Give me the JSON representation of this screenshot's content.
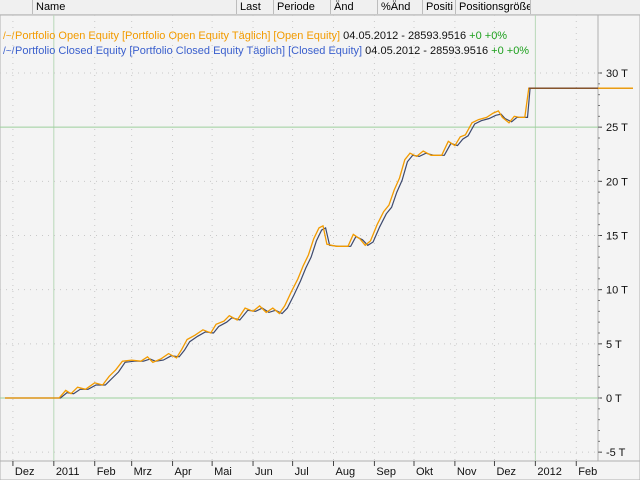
{
  "header": {
    "columns": [
      {
        "label": ""
      },
      {
        "label": "Name"
      },
      {
        "label": "Last"
      },
      {
        "label": "Periode"
      },
      {
        "label": "Änd"
      },
      {
        "label": "%Änd"
      },
      {
        "label": "Positi"
      },
      {
        "label": "Positionsgröße"
      }
    ]
  },
  "legend": {
    "open": {
      "name": "Portfolio Open Equity [Portfolio Open Equity  Täglich] [Open Equity]",
      "value": "04.05.2012 - 28593.9516",
      "change": "+0 +0%"
    },
    "closed": {
      "name": "Portfolio Closed Equity [Portfolio Closed Equity  Täglich] [Closed Equity]",
      "value": "04.05.2012 - 28593.9516",
      "change": "+0 +0%"
    }
  },
  "colors": {
    "open_equity": "#f29b00",
    "closed_equity": "#3e4a6e",
    "flat_line": "#7a4a2a",
    "zero_line": "#9ccf9c",
    "plot_bg": "#f4f4f4"
  },
  "chart_data": {
    "type": "line",
    "title": "",
    "xlabel": "",
    "ylabel": "",
    "ylim": [
      -5000,
      31000
    ],
    "y_ticks": [
      {
        "value": 30000,
        "label": "30 T"
      },
      {
        "value": 25000,
        "label": "25 T"
      },
      {
        "value": 20000,
        "label": "20 T"
      },
      {
        "value": 15000,
        "label": "15 T"
      },
      {
        "value": 10000,
        "label": "10 T"
      },
      {
        "value": 5000,
        "label": "5 T"
      },
      {
        "value": 0,
        "label": "0 T"
      },
      {
        "value": -5000,
        "label": "-5 T"
      }
    ],
    "x_ticks": [
      "Dez",
      "2011",
      "Feb",
      "Mrz",
      "Apr",
      "Mai",
      "Jun",
      "Jul",
      "Aug",
      "Sep",
      "Okt",
      "Nov",
      "Dez",
      "2012",
      "Feb"
    ],
    "x_range": [
      "2010-11-25",
      "2012-03-15"
    ],
    "grid": true,
    "legend_position": "top-left",
    "series": [
      {
        "name": "Portfolio Open Equity",
        "color": "orange",
        "points": [
          [
            "2010-11-25",
            0
          ],
          [
            "2010-12-28",
            0
          ],
          [
            "2011-01-05",
            0
          ],
          [
            "2011-01-10",
            700
          ],
          [
            "2011-01-14",
            400
          ],
          [
            "2011-01-19",
            1000
          ],
          [
            "2011-01-25",
            800
          ],
          [
            "2011-02-01",
            1400
          ],
          [
            "2011-02-07",
            1200
          ],
          [
            "2011-02-12",
            2000
          ],
          [
            "2011-02-17",
            2600
          ],
          [
            "2011-02-22",
            3400
          ],
          [
            "2011-03-01",
            3500
          ],
          [
            "2011-03-08",
            3400
          ],
          [
            "2011-03-13",
            3800
          ],
          [
            "2011-03-17",
            3300
          ],
          [
            "2011-03-23",
            3600
          ],
          [
            "2011-03-29",
            4100
          ],
          [
            "2011-04-04",
            3700
          ],
          [
            "2011-04-08",
            4500
          ],
          [
            "2011-04-12",
            5400
          ],
          [
            "2011-04-18",
            5800
          ],
          [
            "2011-04-24",
            6300
          ],
          [
            "2011-04-30",
            6000
          ],
          [
            "2011-05-04",
            6800
          ],
          [
            "2011-05-10",
            7100
          ],
          [
            "2011-05-14",
            7600
          ],
          [
            "2011-05-20",
            7200
          ],
          [
            "2011-05-26",
            8300
          ],
          [
            "2011-06-01",
            8000
          ],
          [
            "2011-06-06",
            8500
          ],
          [
            "2011-06-11",
            7900
          ],
          [
            "2011-06-16",
            8300
          ],
          [
            "2011-06-21",
            7800
          ],
          [
            "2011-06-25",
            8500
          ],
          [
            "2011-06-30",
            9800
          ],
          [
            "2011-07-05",
            11000
          ],
          [
            "2011-07-09",
            12200
          ],
          [
            "2011-07-13",
            13200
          ],
          [
            "2011-07-17",
            14700
          ],
          [
            "2011-07-21",
            15700
          ],
          [
            "2011-07-24",
            15900
          ],
          [
            "2011-07-27",
            14200
          ],
          [
            "2011-08-03",
            14000
          ],
          [
            "2011-08-12",
            14000
          ],
          [
            "2011-08-16",
            15100
          ],
          [
            "2011-08-21",
            14700
          ],
          [
            "2011-08-25",
            14100
          ],
          [
            "2011-08-29",
            14500
          ],
          [
            "2011-09-03",
            16000
          ],
          [
            "2011-09-08",
            17200
          ],
          [
            "2011-09-12",
            17800
          ],
          [
            "2011-09-16",
            19200
          ],
          [
            "2011-09-20",
            20300
          ],
          [
            "2011-09-24",
            22000
          ],
          [
            "2011-09-28",
            22600
          ],
          [
            "2011-10-03",
            22300
          ],
          [
            "2011-10-08",
            22800
          ],
          [
            "2011-10-14",
            22400
          ],
          [
            "2011-10-22",
            22400
          ],
          [
            "2011-10-27",
            23700
          ],
          [
            "2011-11-01",
            23300
          ],
          [
            "2011-11-05",
            24100
          ],
          [
            "2011-11-09",
            24300
          ],
          [
            "2011-11-14",
            25400
          ],
          [
            "2011-11-19",
            25700
          ],
          [
            "2011-11-25",
            25900
          ],
          [
            "2011-11-30",
            26300
          ],
          [
            "2011-12-04",
            26500
          ],
          [
            "2011-12-07",
            25900
          ],
          [
            "2011-12-12",
            25400
          ],
          [
            "2011-12-16",
            26000
          ],
          [
            "2011-12-20",
            25900
          ],
          [
            "2011-12-24",
            25900
          ],
          [
            "2011-12-27",
            28600
          ],
          [
            "2012-03-15",
            28600
          ]
        ]
      },
      {
        "name": "Portfolio Closed Equity",
        "color": "dark-navy",
        "points": [
          [
            "2010-11-25",
            0
          ],
          [
            "2010-12-28",
            0
          ],
          [
            "2011-01-06",
            0
          ],
          [
            "2011-01-11",
            500
          ],
          [
            "2011-01-16",
            400
          ],
          [
            "2011-01-21",
            800
          ],
          [
            "2011-01-27",
            800
          ],
          [
            "2011-02-02",
            1200
          ],
          [
            "2011-02-09",
            1200
          ],
          [
            "2011-02-14",
            1800
          ],
          [
            "2011-02-19",
            2400
          ],
          [
            "2011-02-24",
            3300
          ],
          [
            "2011-03-03",
            3400
          ],
          [
            "2011-03-10",
            3400
          ],
          [
            "2011-03-15",
            3600
          ],
          [
            "2011-03-19",
            3400
          ],
          [
            "2011-03-25",
            3500
          ],
          [
            "2011-03-31",
            3900
          ],
          [
            "2011-04-06",
            3800
          ],
          [
            "2011-04-10",
            4400
          ],
          [
            "2011-04-14",
            5200
          ],
          [
            "2011-04-20",
            5700
          ],
          [
            "2011-04-26",
            6100
          ],
          [
            "2011-05-02",
            6000
          ],
          [
            "2011-05-06",
            6600
          ],
          [
            "2011-05-12",
            7000
          ],
          [
            "2011-05-16",
            7400
          ],
          [
            "2011-05-22",
            7200
          ],
          [
            "2011-05-28",
            8100
          ],
          [
            "2011-06-03",
            8000
          ],
          [
            "2011-06-08",
            8300
          ],
          [
            "2011-06-13",
            7900
          ],
          [
            "2011-06-18",
            8100
          ],
          [
            "2011-06-23",
            7800
          ],
          [
            "2011-06-27",
            8300
          ],
          [
            "2011-07-02",
            9500
          ],
          [
            "2011-07-07",
            10800
          ],
          [
            "2011-07-11",
            12000
          ],
          [
            "2011-07-15",
            13000
          ],
          [
            "2011-07-19",
            14500
          ],
          [
            "2011-07-23",
            15500
          ],
          [
            "2011-07-26",
            15700
          ],
          [
            "2011-07-29",
            14100
          ],
          [
            "2011-08-05",
            14000
          ],
          [
            "2011-08-14",
            14000
          ],
          [
            "2011-08-18",
            14900
          ],
          [
            "2011-08-23",
            14600
          ],
          [
            "2011-08-27",
            14100
          ],
          [
            "2011-08-31",
            14400
          ],
          [
            "2011-09-05",
            15800
          ],
          [
            "2011-09-10",
            17000
          ],
          [
            "2011-09-14",
            17600
          ],
          [
            "2011-09-18",
            19000
          ],
          [
            "2011-09-22",
            20100
          ],
          [
            "2011-09-26",
            21800
          ],
          [
            "2011-09-30",
            22400
          ],
          [
            "2011-10-05",
            22300
          ],
          [
            "2011-10-10",
            22600
          ],
          [
            "2011-10-16",
            22400
          ],
          [
            "2011-10-24",
            22400
          ],
          [
            "2011-10-29",
            23500
          ],
          [
            "2011-11-03",
            23300
          ],
          [
            "2011-11-07",
            23900
          ],
          [
            "2011-11-11",
            24200
          ],
          [
            "2011-11-16",
            25300
          ],
          [
            "2011-11-21",
            25600
          ],
          [
            "2011-11-27",
            25800
          ],
          [
            "2011-12-02",
            26100
          ],
          [
            "2011-12-06",
            26200
          ],
          [
            "2011-12-09",
            25800
          ],
          [
            "2011-12-14",
            25500
          ],
          [
            "2011-12-18",
            25900
          ],
          [
            "2011-12-22",
            25900
          ],
          [
            "2011-12-26",
            25900
          ],
          [
            "2011-12-28",
            28600
          ],
          [
            "2012-03-15",
            28600
          ]
        ]
      }
    ]
  }
}
